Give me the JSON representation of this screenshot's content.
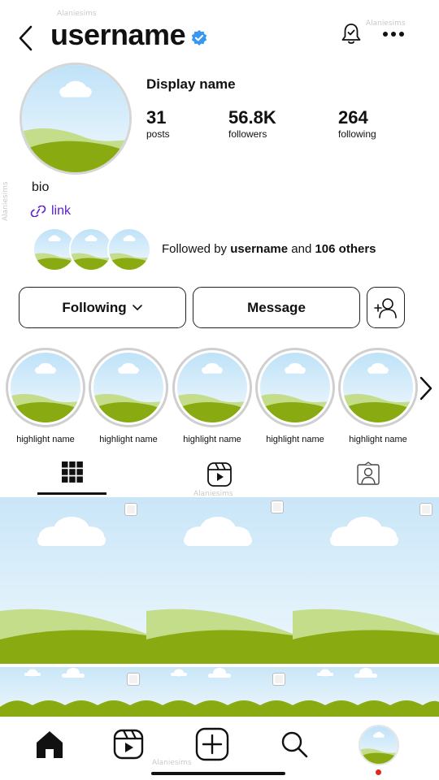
{
  "header": {
    "username": "username",
    "watermark": "Alaniesims"
  },
  "profile": {
    "display_name": "Display name",
    "stats": [
      {
        "count": "31",
        "label": "posts"
      },
      {
        "count": "56.8K",
        "label": "followers"
      },
      {
        "count": "264",
        "label": "following"
      }
    ],
    "bio": "bio",
    "link": "link",
    "followed_by": {
      "prefix": "Followed by ",
      "user": "username",
      "middle": " and ",
      "others": "106 others"
    }
  },
  "actions": {
    "following_label": "Following",
    "message_label": "Message"
  },
  "highlights": [
    {
      "label": "highlight name"
    },
    {
      "label": "highlight name"
    },
    {
      "label": "highlight name"
    },
    {
      "label": "highlight name"
    },
    {
      "label": "highlight name"
    }
  ],
  "tabs": [
    {
      "icon": "grid-icon",
      "active": true
    },
    {
      "icon": "reels-icon",
      "active": false
    },
    {
      "icon": "tagged-icon",
      "active": false
    }
  ],
  "nav": [
    "home-icon",
    "reels-icon",
    "create-icon",
    "search-icon",
    "profile-avatar"
  ],
  "colors": {
    "verified": "#3897f0",
    "link": "#5b1fd0",
    "sky": "#cfe8f7",
    "grass_light": "#c3dd8b",
    "grass_dark": "#8aaa12",
    "notification_dot": "#e3261c"
  }
}
